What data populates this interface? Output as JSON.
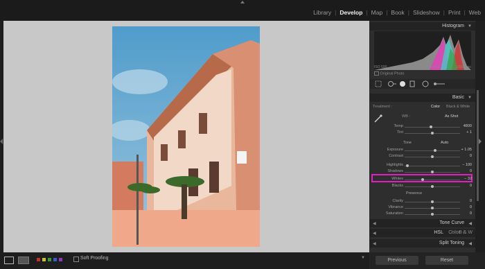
{
  "modules": [
    "Library",
    "Develop",
    "Map",
    "Book",
    "Slideshow",
    "Print",
    "Web"
  ],
  "active_module": "Develop",
  "histogram": {
    "title": "Histogram",
    "iso": "ISO 500",
    "focal": "18 mm",
    "aperture": "f / 9.0",
    "shutter": "1/160 sec",
    "original_photo": "Original Photo"
  },
  "basic": {
    "title": "Basic",
    "treatment_label": "Treatment :",
    "color": "Color",
    "bw": "Black & White",
    "wb_label": "WB :",
    "wb_value": "As Shot",
    "tone_label": "Tone",
    "auto_label": "Auto",
    "presence_label": "Presence"
  },
  "sliders": [
    {
      "label": "Temp",
      "value": "4800",
      "pos": 0.47
    },
    {
      "label": "Tint",
      "value": "+ 1",
      "pos": 0.5
    },
    {
      "label": "Exposure",
      "value": "+ 1.05",
      "pos": 0.55
    },
    {
      "label": "Contrast",
      "value": "0",
      "pos": 0.5
    },
    {
      "label": "Highlights",
      "value": "− 100",
      "pos": 0.05
    },
    {
      "label": "Shadows",
      "value": "0",
      "pos": 0.5
    },
    {
      "label": "Whites",
      "value": "− 32",
      "pos": 0.33
    },
    {
      "label": "Blacks",
      "value": "0",
      "pos": 0.5
    },
    {
      "label": "Clarity",
      "value": "0",
      "pos": 0.5
    },
    {
      "label": "Vibrance",
      "value": "0",
      "pos": 0.5
    },
    {
      "label": "Saturation",
      "value": "0",
      "pos": 0.5
    }
  ],
  "collapsed_sections": {
    "tone_curve": "Tone Curve",
    "hsl": "HSL",
    "hsl_color": "Color",
    "hsl_bw": "B & W",
    "split_toning": "Split Toning"
  },
  "toolbar": {
    "soft_proofing": "Soft Proofing"
  },
  "buttons": {
    "previous": "Previous",
    "reset": "Reset"
  },
  "colors": {
    "highlight": "#e020c0",
    "accent": "#f2f2f2"
  }
}
